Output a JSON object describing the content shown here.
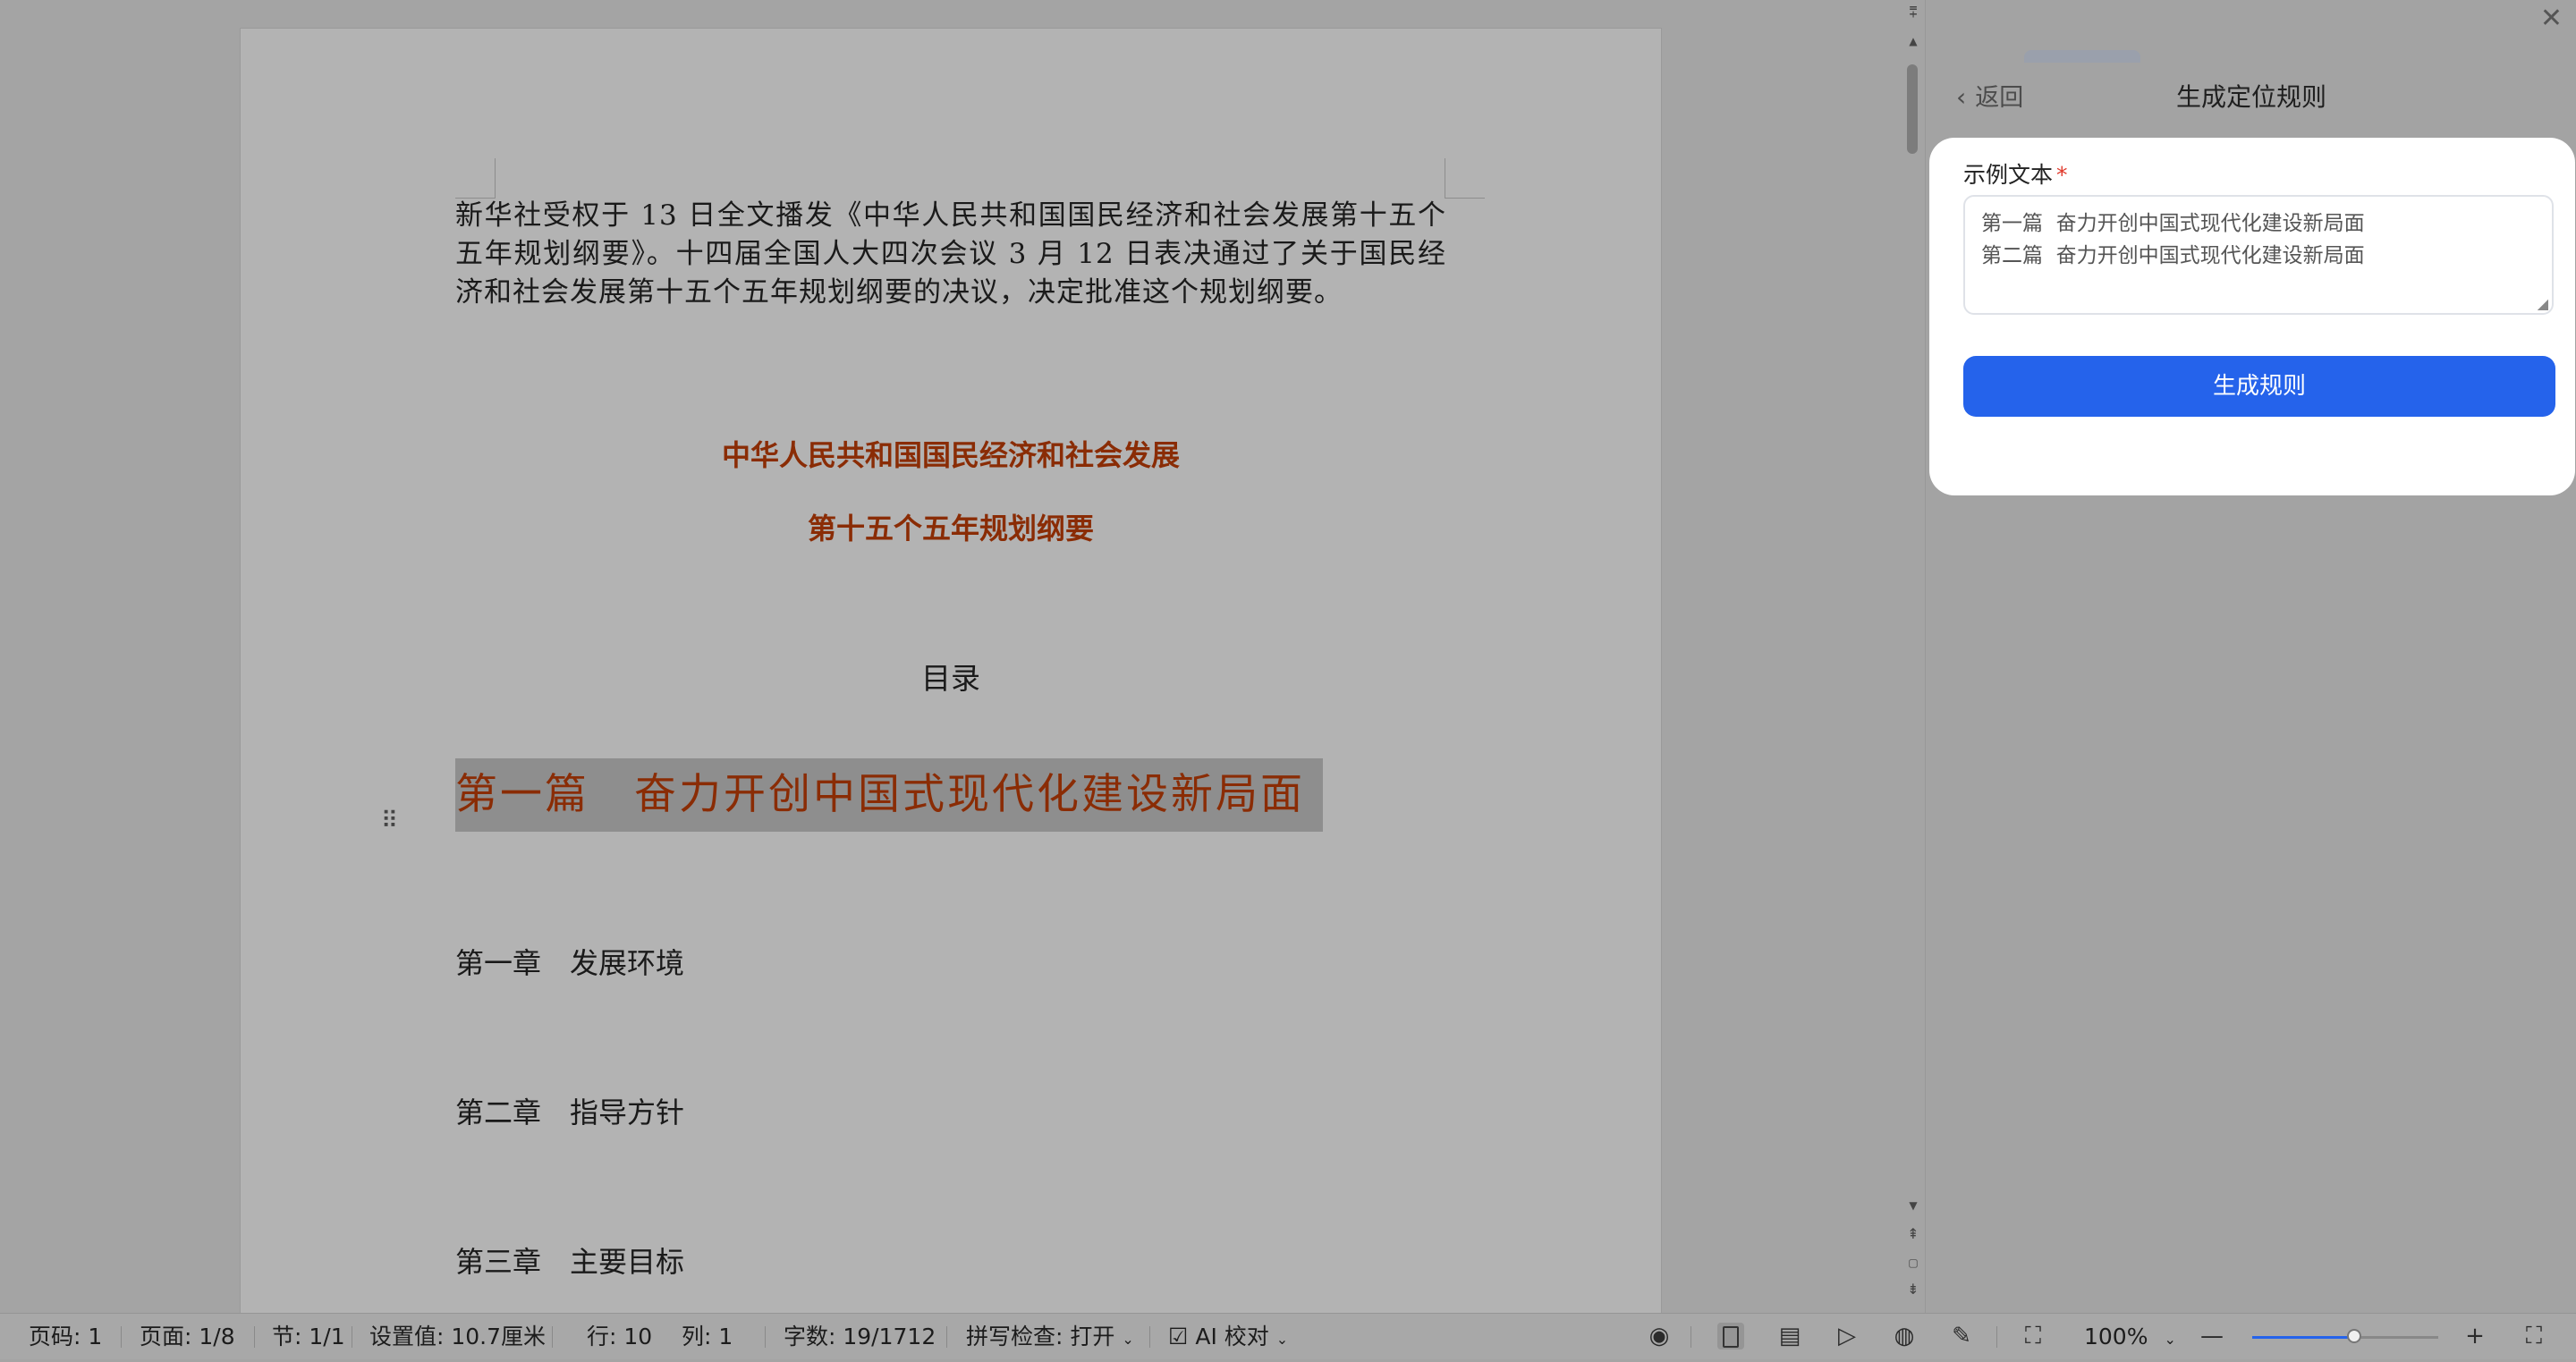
{
  "document": {
    "intro": "新华社受权于 13 日全文播发《中华人民共和国国民经济和社会发展第十五个五年规划纲要》。十四届全国人大四次会议 3 月 12 日表决通过了关于国民经济和社会发展第十五个五年规划纲要的决议，决定批准这个规划纲要。",
    "title_line1": "中华人民共和国国民经济和社会发展",
    "title_line2": "第十五个五年规划纲要",
    "toc": "目录",
    "part1": "第一篇　奋力开创中国式现代化建设新局面",
    "chapters": [
      "第一章　发展环境",
      "第二章　指导方针",
      "第三章　主要目标"
    ]
  },
  "panel": {
    "back_label": "返回",
    "title": "生成定位规则",
    "field_label": "示例文本",
    "required_mark": "*",
    "example_lines": [
      "第一篇  奋力开创中国式现代化建设新局面",
      "第二篇  奋力开创中国式现代化建设新局面"
    ],
    "generate_button": "生成规则"
  },
  "statusbar": {
    "page_no": "页码: 1",
    "pages": "页面: 1/8",
    "section": "节: 1/1",
    "setting": "设置值: 10.7厘米",
    "row": "行: 10",
    "col": "列: 1",
    "word_count": "字数: 19/1712",
    "spellcheck": "拼写检查: 打开",
    "ai_check": "AI 校对",
    "zoom": "100%",
    "zoom_level": 0.55
  },
  "colors": {
    "accent": "#2563eb",
    "heading": "#8a2c05"
  }
}
